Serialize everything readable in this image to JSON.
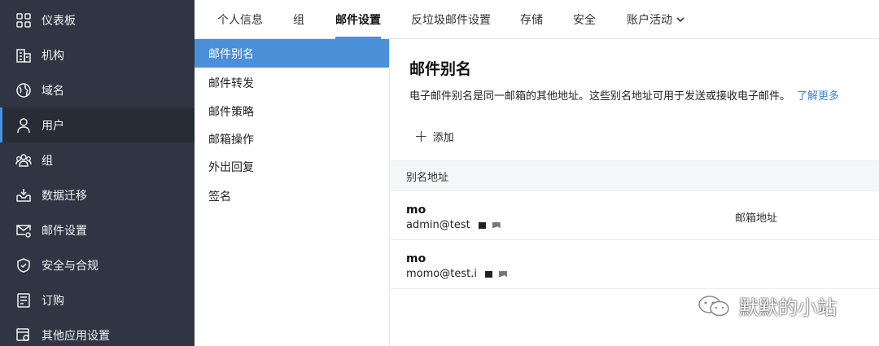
{
  "sidebar": {
    "items": [
      {
        "label": "仪表板",
        "icon": "dashboard-icon",
        "active": false
      },
      {
        "label": "机构",
        "icon": "building-icon",
        "active": false
      },
      {
        "label": "域名",
        "icon": "globe-icon",
        "active": false
      },
      {
        "label": "用户",
        "icon": "user-icon",
        "active": true
      },
      {
        "label": "组",
        "icon": "group-icon",
        "active": false
      },
      {
        "label": "数据迁移",
        "icon": "inbox-download-icon",
        "active": false
      },
      {
        "label": "邮件设置",
        "icon": "mail-settings-icon",
        "active": false
      },
      {
        "label": "安全与合规",
        "icon": "shield-icon",
        "active": false
      },
      {
        "label": "订购",
        "icon": "receipt-icon",
        "active": false
      },
      {
        "label": "其他应用设置",
        "icon": "apps-settings-icon",
        "active": false
      }
    ]
  },
  "tabs": [
    {
      "label": "个人信息",
      "active": false
    },
    {
      "label": "组",
      "active": false
    },
    {
      "label": "邮件设置",
      "active": true
    },
    {
      "label": "反垃圾邮件设置",
      "active": false
    },
    {
      "label": "存储",
      "active": false
    },
    {
      "label": "安全",
      "active": false
    },
    {
      "label": "账户活动",
      "active": false,
      "dropdown": true
    }
  ],
  "submenu": [
    {
      "label": "邮件别名",
      "active": true
    },
    {
      "label": "邮件转发",
      "active": false
    },
    {
      "label": "邮件策略",
      "active": false
    },
    {
      "label": "邮箱操作",
      "active": false
    },
    {
      "label": "外出回复",
      "active": false
    },
    {
      "label": "签名",
      "active": false
    }
  ],
  "main": {
    "title": "邮件别名",
    "description": "电子邮件别名是同一邮箱的其他地址。这些别名地址可用于发送或接收电子邮件。",
    "learn_more": "了解更多",
    "add_label": "添加",
    "table_header": "别名地址",
    "rows": [
      {
        "name": "mo",
        "email": "admin@test",
        "type": "邮箱地址"
      },
      {
        "name": "mo",
        "email": "momo@test.i",
        "type": ""
      }
    ]
  },
  "watermark": "默默的小站",
  "colors": {
    "sidebar_bg": "#2f3542",
    "accent": "#4a90e2",
    "submenu_active": "#4a8fd8",
    "link": "#3a85d6"
  }
}
